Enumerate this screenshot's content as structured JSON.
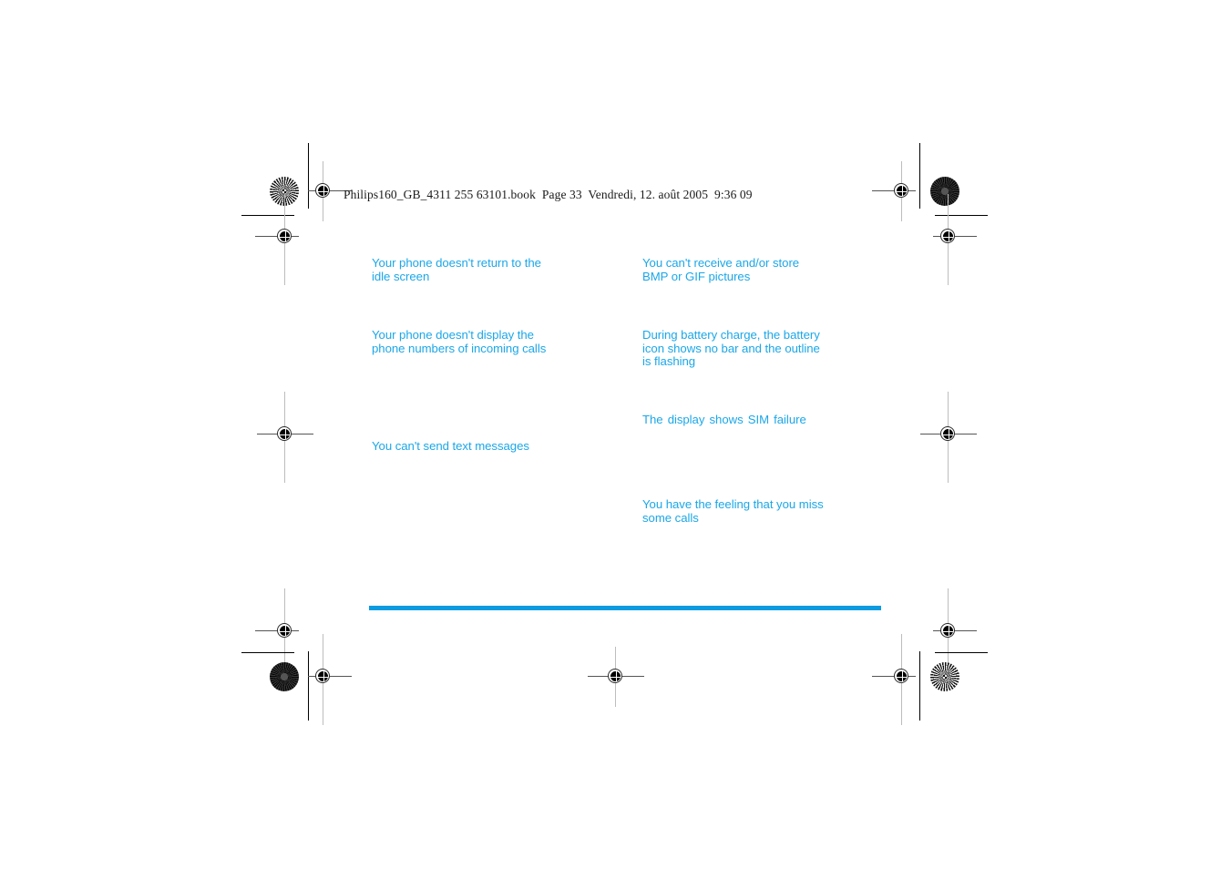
{
  "document": {
    "header_text": "Philips160_GB_4311 255 63101.book  Page 33  Vendredi, 12. août 2005  9:36 09",
    "book_name": "Philips160_GB_4311 255 63101.book",
    "page_label": "Page 33",
    "date_label": "Vendredi, 12. août 2005",
    "time_label": "9:36 09"
  },
  "colors": {
    "heading_blue": "#1BA7E8",
    "rule_blue": "#0C9BE0",
    "mark_black": "#000000",
    "guide_gray": "#bdbdbd"
  },
  "left_column": {
    "entries": [
      {
        "id": "idle-screen",
        "text": "Your phone doesn't return to the idle screen"
      },
      {
        "id": "incoming-numbers",
        "text": "Your phone doesn't display the phone numbers of incoming calls"
      },
      {
        "id": "send-text",
        "text": "You can't send text messages"
      }
    ]
  },
  "right_column": {
    "entries": [
      {
        "id": "bmp-gif",
        "text": "You can't receive and/or store BMP or GIF pictures"
      },
      {
        "id": "battery-charge",
        "text": "During battery charge, the battery icon shows no bar and the outline is flashing"
      },
      {
        "id": "sim-failure",
        "text": "The display shows SIM failure"
      },
      {
        "id": "missed-calls",
        "text": "You have the feeling that you miss some calls"
      }
    ]
  },
  "marks": {
    "registration_name": "registration-target",
    "burst_name": "star-burst-target",
    "crop_name": "crop-mark"
  }
}
